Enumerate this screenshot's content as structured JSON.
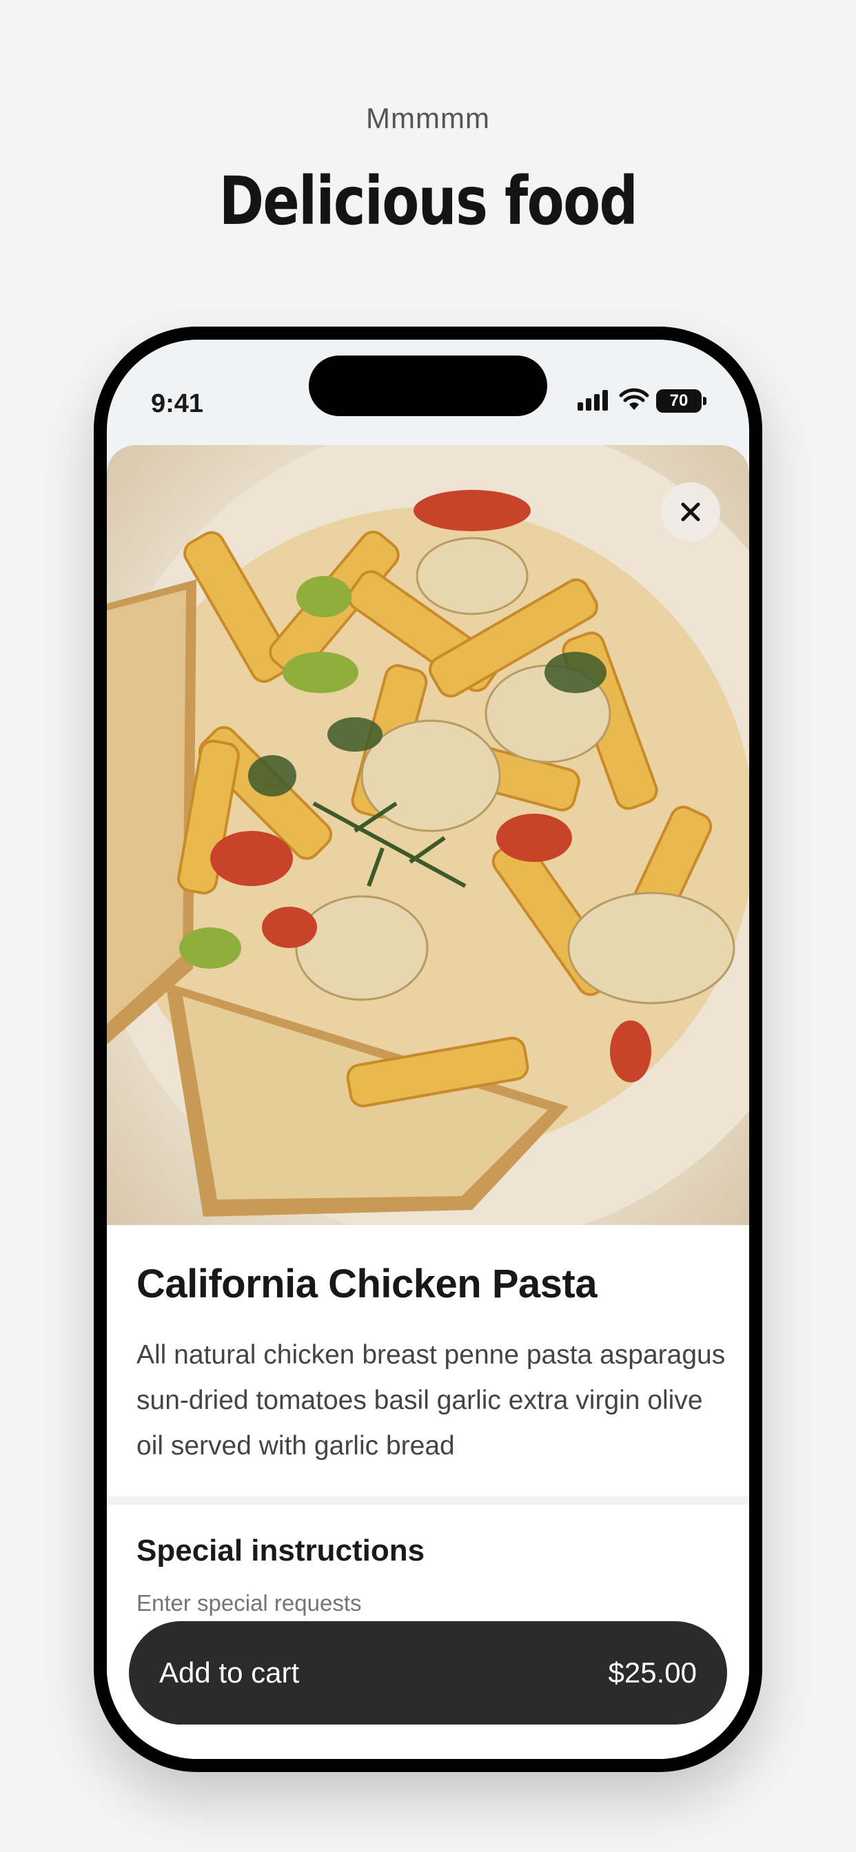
{
  "page": {
    "kicker": "Mmmmm",
    "headline": "Delicious food"
  },
  "status_bar": {
    "time": "9:41",
    "battery": "70",
    "icons": [
      "cellular-signal-icon",
      "wifi-icon",
      "battery-icon"
    ]
  },
  "item": {
    "image_icon": "food-photo",
    "close_icon": "close-icon",
    "title": "California Chicken Pasta",
    "description": "All natural chicken breast penne pasta asparagus sun-dried tomatoes basil garlic extra virgin olive oil served with garlic bread"
  },
  "special_instructions": {
    "title": "Special instructions",
    "placeholder": "Enter special requests",
    "value": ""
  },
  "cart": {
    "label": "Add to cart",
    "price": "$25.00"
  },
  "colors": {
    "background": "#f4f4f4",
    "cart_button": "#2b2b2b",
    "text_primary": "#1a1a1a",
    "text_secondary": "#444444"
  }
}
